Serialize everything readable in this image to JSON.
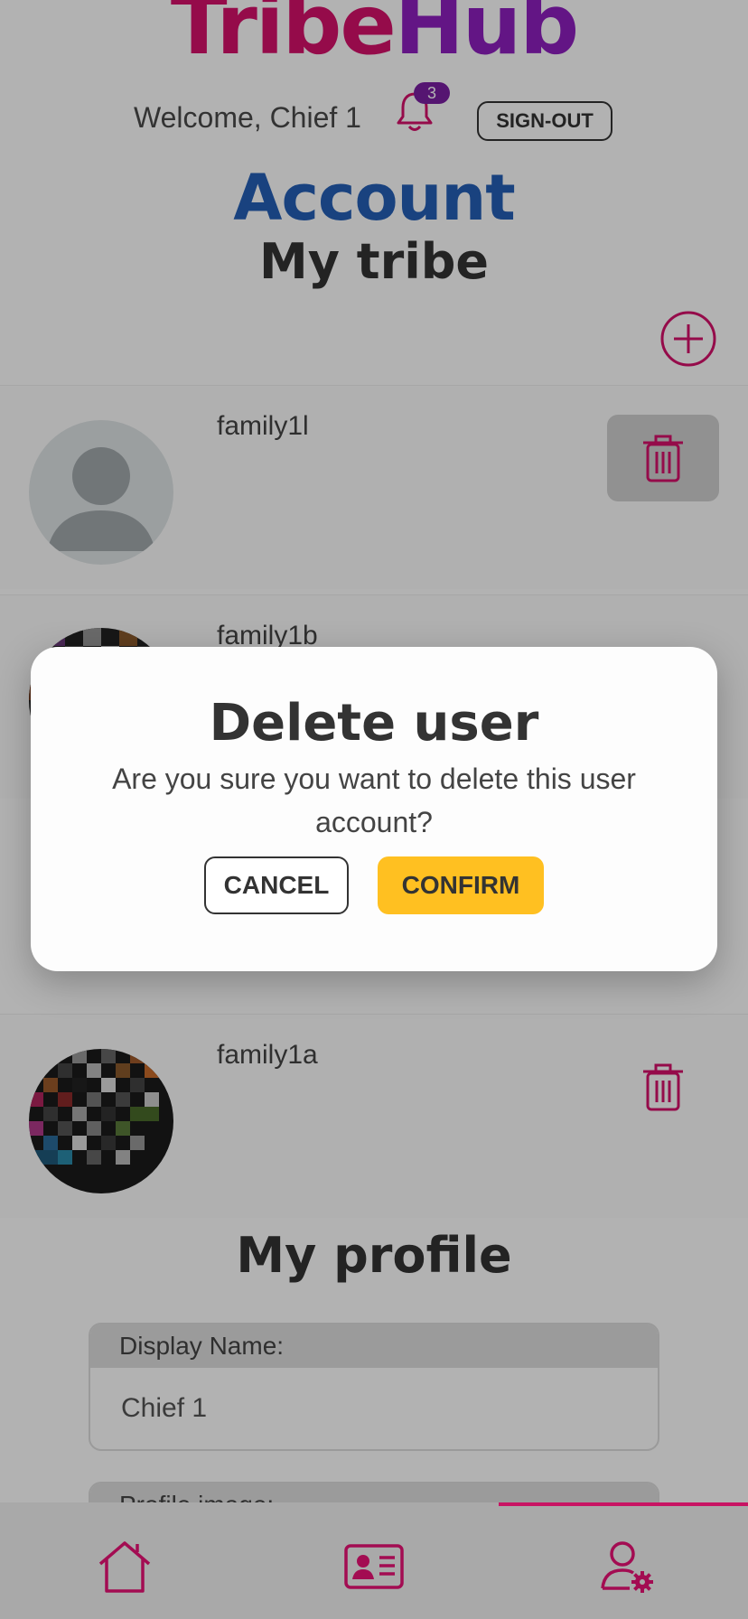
{
  "header": {
    "logo_part1": "Tribe",
    "logo_part2": "Hub",
    "welcome_text": "Welcome, Chief 1",
    "notification_count": "3",
    "signout_label": "SIGN-OUT"
  },
  "page_title": "Account",
  "tribe": {
    "title": "My tribe",
    "members": [
      {
        "name": "family1l"
      },
      {
        "name": "family1b"
      },
      {
        "name": "family1a"
      }
    ]
  },
  "profile": {
    "title": "My profile",
    "display_name_label": "Display Name:",
    "display_name_value": "Chief 1",
    "profile_image_label": "Profile image:"
  },
  "dialog": {
    "title": "Delete user",
    "message": "Are you sure you want to delete this user account?",
    "cancel_label": "CANCEL",
    "confirm_label": "CONFIRM"
  },
  "nav": {
    "items": [
      {
        "icon": "home-icon"
      },
      {
        "icon": "profile-card-icon"
      },
      {
        "icon": "user-settings-icon",
        "active": true
      }
    ]
  },
  "colors": {
    "brand_pink": "#d6116b",
    "brand_purple": "#8e1fbf",
    "accent_blue": "#245fb6",
    "confirm_yellow": "#ffc021"
  }
}
